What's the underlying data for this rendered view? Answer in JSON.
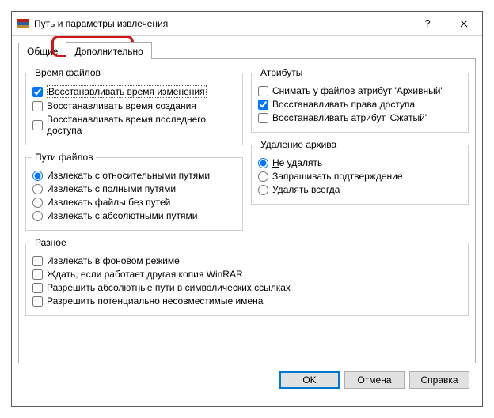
{
  "window": {
    "title": "Путь и параметры извлечения"
  },
  "tabs": {
    "general": "Общие",
    "advanced": "Дополнительно"
  },
  "groups": {
    "file_time": {
      "legend": "Время файлов",
      "restore_mtime": "Восстанавливать время изменения",
      "restore_ctime": "Восстанавливать время создания",
      "restore_atime": "Восстанавливать время последнего доступа"
    },
    "attributes": {
      "legend": "Атрибуты",
      "clear_archive_attr": "Снимать у файлов атрибут 'Архивный'",
      "restore_permissions": "Восстанавливать права доступа",
      "restore_compressed_prefix": "Восстанавливать атрибут '",
      "restore_compressed_underlined": "С",
      "restore_compressed_suffix": "жатый'"
    },
    "file_paths": {
      "legend": "Пути файлов",
      "relative": "Извлекать с относительными путями",
      "full": "Извлекать с полными путями",
      "none": "Извлекать файлы без путей",
      "absolute": "Извлекать с абсолютными путями"
    },
    "delete_archive": {
      "legend": "Удаление архива",
      "no_delete_underlined": "Н",
      "no_delete_rest": "е удалять",
      "ask": "Запрашивать подтверждение",
      "always": "Удалять всегда"
    },
    "misc": {
      "legend": "Разное",
      "background": "Извлекать в фоновом режиме",
      "wait_other": "Ждать, если работает другая копия WinRAR",
      "allow_abs_symlink": "Разрешить абсолютные пути в символических ссылках",
      "allow_bad_names": "Разрешить потенциально несовместимые имена"
    }
  },
  "buttons": {
    "ok": "OK",
    "cancel": "Отмена",
    "help": "Справка"
  },
  "state": {
    "restore_mtime": true,
    "restore_permissions": true,
    "paths_mode": "relative",
    "delete_mode": "none"
  }
}
